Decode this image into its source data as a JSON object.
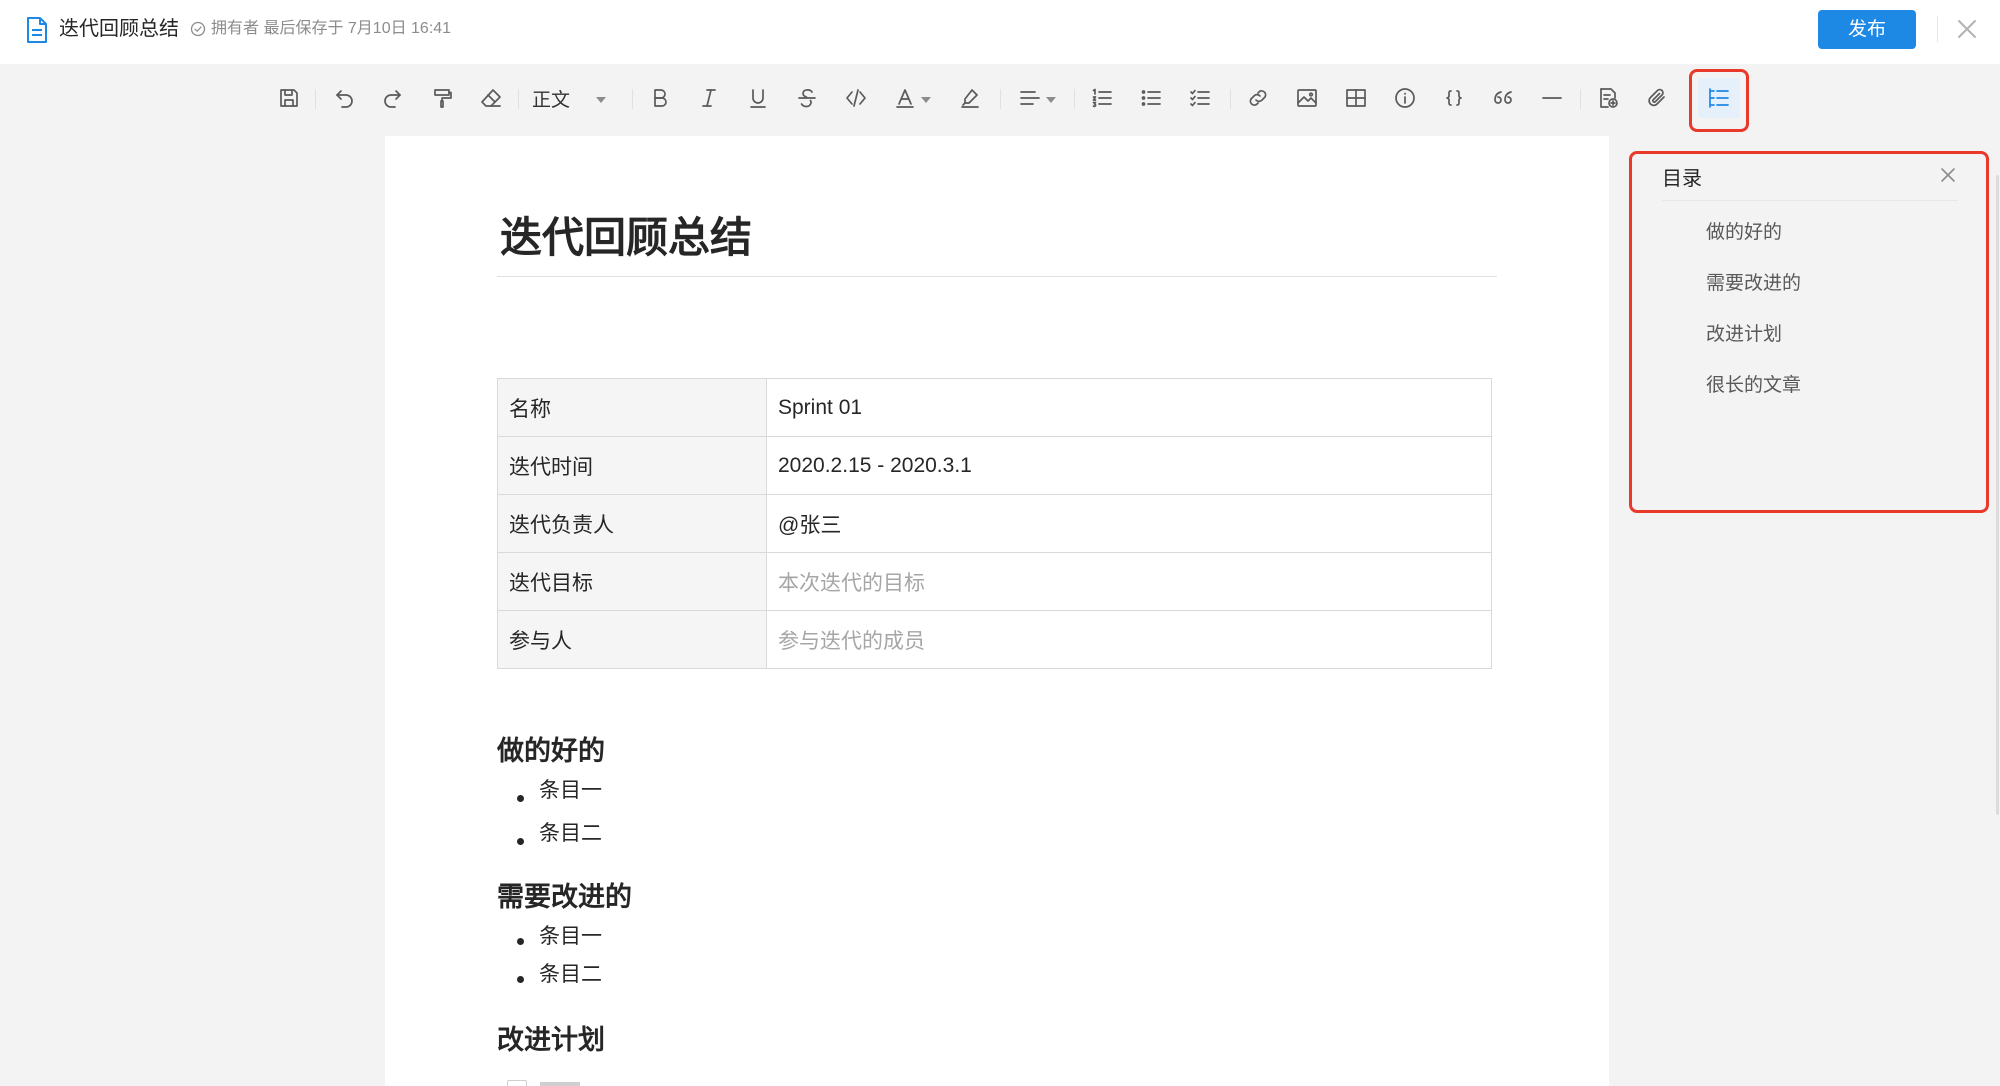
{
  "header": {
    "title": "迭代回顾总结",
    "save_status": "拥有者 最后保存于 7月10日 16:41",
    "publish_label": "发布"
  },
  "toolbar": {
    "paragraph_style": "正文",
    "icons": [
      "save-icon",
      "undo-icon",
      "redo-icon",
      "format-painter-icon",
      "eraser-icon",
      "bold-icon",
      "italic-icon",
      "underline-icon",
      "strikethrough-icon",
      "code-icon",
      "font-color-icon",
      "highlight-icon",
      "align-icon",
      "ordered-list-icon",
      "bullet-list-icon",
      "task-list-icon",
      "link-icon",
      "image-icon",
      "table-icon",
      "info-icon",
      "code-block-icon",
      "quote-icon",
      "divider-icon",
      "embed-icon",
      "attachment-icon",
      "toc-icon"
    ]
  },
  "document": {
    "title": "迭代回顾总结",
    "table": [
      {
        "key": "名称",
        "value": "Sprint 01",
        "placeholder": false
      },
      {
        "key": "迭代时间",
        "value": "2020.2.15 - 2020.3.1",
        "placeholder": false
      },
      {
        "key": "迭代负责人",
        "value": "@张三",
        "placeholder": false
      },
      {
        "key": "迭代目标",
        "value": "本次迭代的目标",
        "placeholder": true
      },
      {
        "key": "参与人",
        "value": "参与迭代的成员",
        "placeholder": true
      }
    ],
    "sections": [
      {
        "heading": "做的好的",
        "items": [
          "条目一",
          "条目二"
        ]
      },
      {
        "heading": "需要改进的",
        "items": [
          "条目一",
          "条目二"
        ]
      },
      {
        "heading": "改进计划",
        "items": []
      }
    ]
  },
  "toc": {
    "title": "目录",
    "items": [
      "做的好的",
      "需要改进的",
      "改进计划",
      "很长的文章"
    ]
  },
  "colors": {
    "accent": "#1e88e5",
    "highlight_border": "#e8392b"
  }
}
